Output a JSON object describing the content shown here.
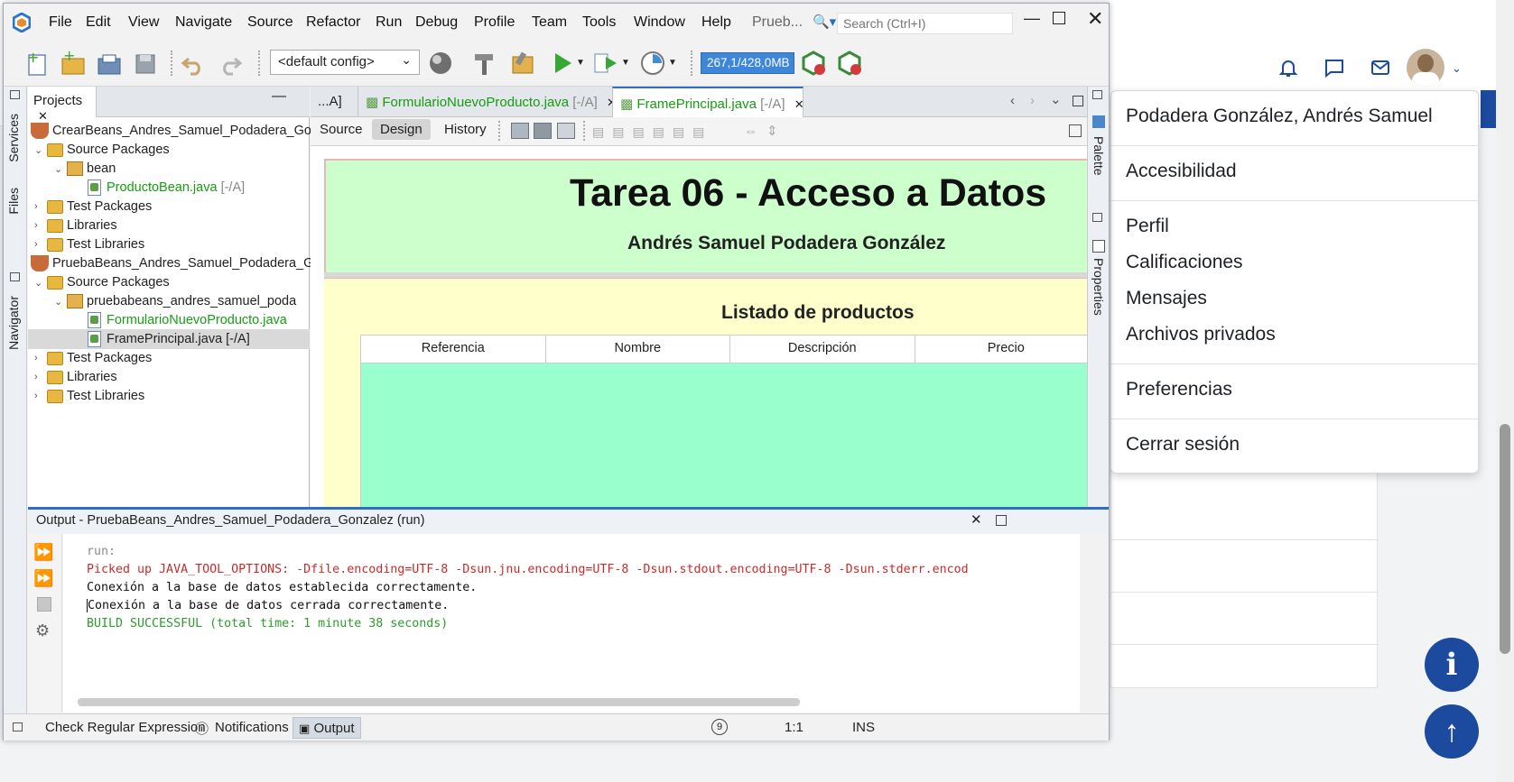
{
  "netbeans": {
    "menu": [
      "File",
      "Edit",
      "View",
      "Navigate",
      "Source",
      "Refactor",
      "Run",
      "Debug",
      "Profile",
      "Team",
      "Tools",
      "Window",
      "Help",
      "Prueb..."
    ],
    "search_placeholder": "Search (Ctrl+I)",
    "config": "<default config>",
    "memory": "267,1/428,0MB",
    "projects_tab": "Projects",
    "side_tabs": {
      "services": "Services",
      "files": "Files",
      "navigator": "Navigator",
      "palette": "Palette",
      "properties": "Properties"
    },
    "tree": [
      {
        "label": "CrearBeans_Andres_Samuel_Podadera_Go"
      },
      {
        "label": "Source Packages"
      },
      {
        "label": "bean"
      },
      {
        "label": "ProductoBean.java",
        "suffix": "[-/A]"
      },
      {
        "label": "Test Packages"
      },
      {
        "label": "Libraries"
      },
      {
        "label": "Test Libraries"
      },
      {
        "label": "PruebaBeans_Andres_Samuel_Podadera_G"
      },
      {
        "label": "Source Packages"
      },
      {
        "label": "pruebabeans_andres_samuel_poda"
      },
      {
        "label": "FormularioNuevoProducto.java"
      },
      {
        "label": "FramePrincipal.java [-/A]"
      },
      {
        "label": "Test Packages"
      },
      {
        "label": "Libraries"
      },
      {
        "label": "Test Libraries"
      }
    ],
    "editor_tabs": [
      {
        "label": "...A]"
      },
      {
        "label": "FormularioNuevoProducto.java",
        "suffix": "[-/A]"
      },
      {
        "label": "FramePrincipal.java",
        "suffix": "[-/A]"
      }
    ],
    "view_tabs": {
      "source": "Source",
      "design": "Design",
      "history": "History"
    },
    "design": {
      "title": "Tarea 06 - Acceso a Datos",
      "author": "Andrés Samuel Podadera González",
      "list_title": "Listado de productos",
      "columns": [
        "Referencia",
        "Nombre",
        "Descripción",
        "Precio"
      ],
      "colors": {
        "header_bg": "#ccffcc",
        "body_bg": "#ffffcc",
        "table_bg": "#99ffcc"
      }
    },
    "output": {
      "title": "Output - PruebaBeans_Andres_Samuel_Podadera_Gonzalez (run)",
      "lines": [
        "run:",
        "Picked up JAVA_TOOL_OPTIONS: -Dfile.encoding=UTF-8 -Dsun.jnu.encoding=UTF-8 -Dsun.stdout.encoding=UTF-8 -Dsun.stderr.encod",
        "Conexión a la base de datos establecida correctamente.",
        "Conexión a la base de datos cerrada correctamente.",
        "BUILD SUCCESSFUL (total time: 1 minute 38 seconds)"
      ]
    },
    "status": {
      "check_regex": "Check Regular Expression",
      "notifications": "Notifications",
      "output": "Output",
      "badge": "9",
      "position": "1:1",
      "mode": "INS"
    }
  },
  "user_menu": {
    "name": "Podadera González, Andrés Samuel",
    "items": [
      "Accesibilidad",
      "Perfil",
      "Calificaciones",
      "Mensajes",
      "Archivos privados",
      "Preferencias",
      "Cerrar sesión"
    ]
  },
  "web": {
    "accent": "#1c4a9e",
    "info_glyph": "i",
    "up_glyph": "↑"
  }
}
